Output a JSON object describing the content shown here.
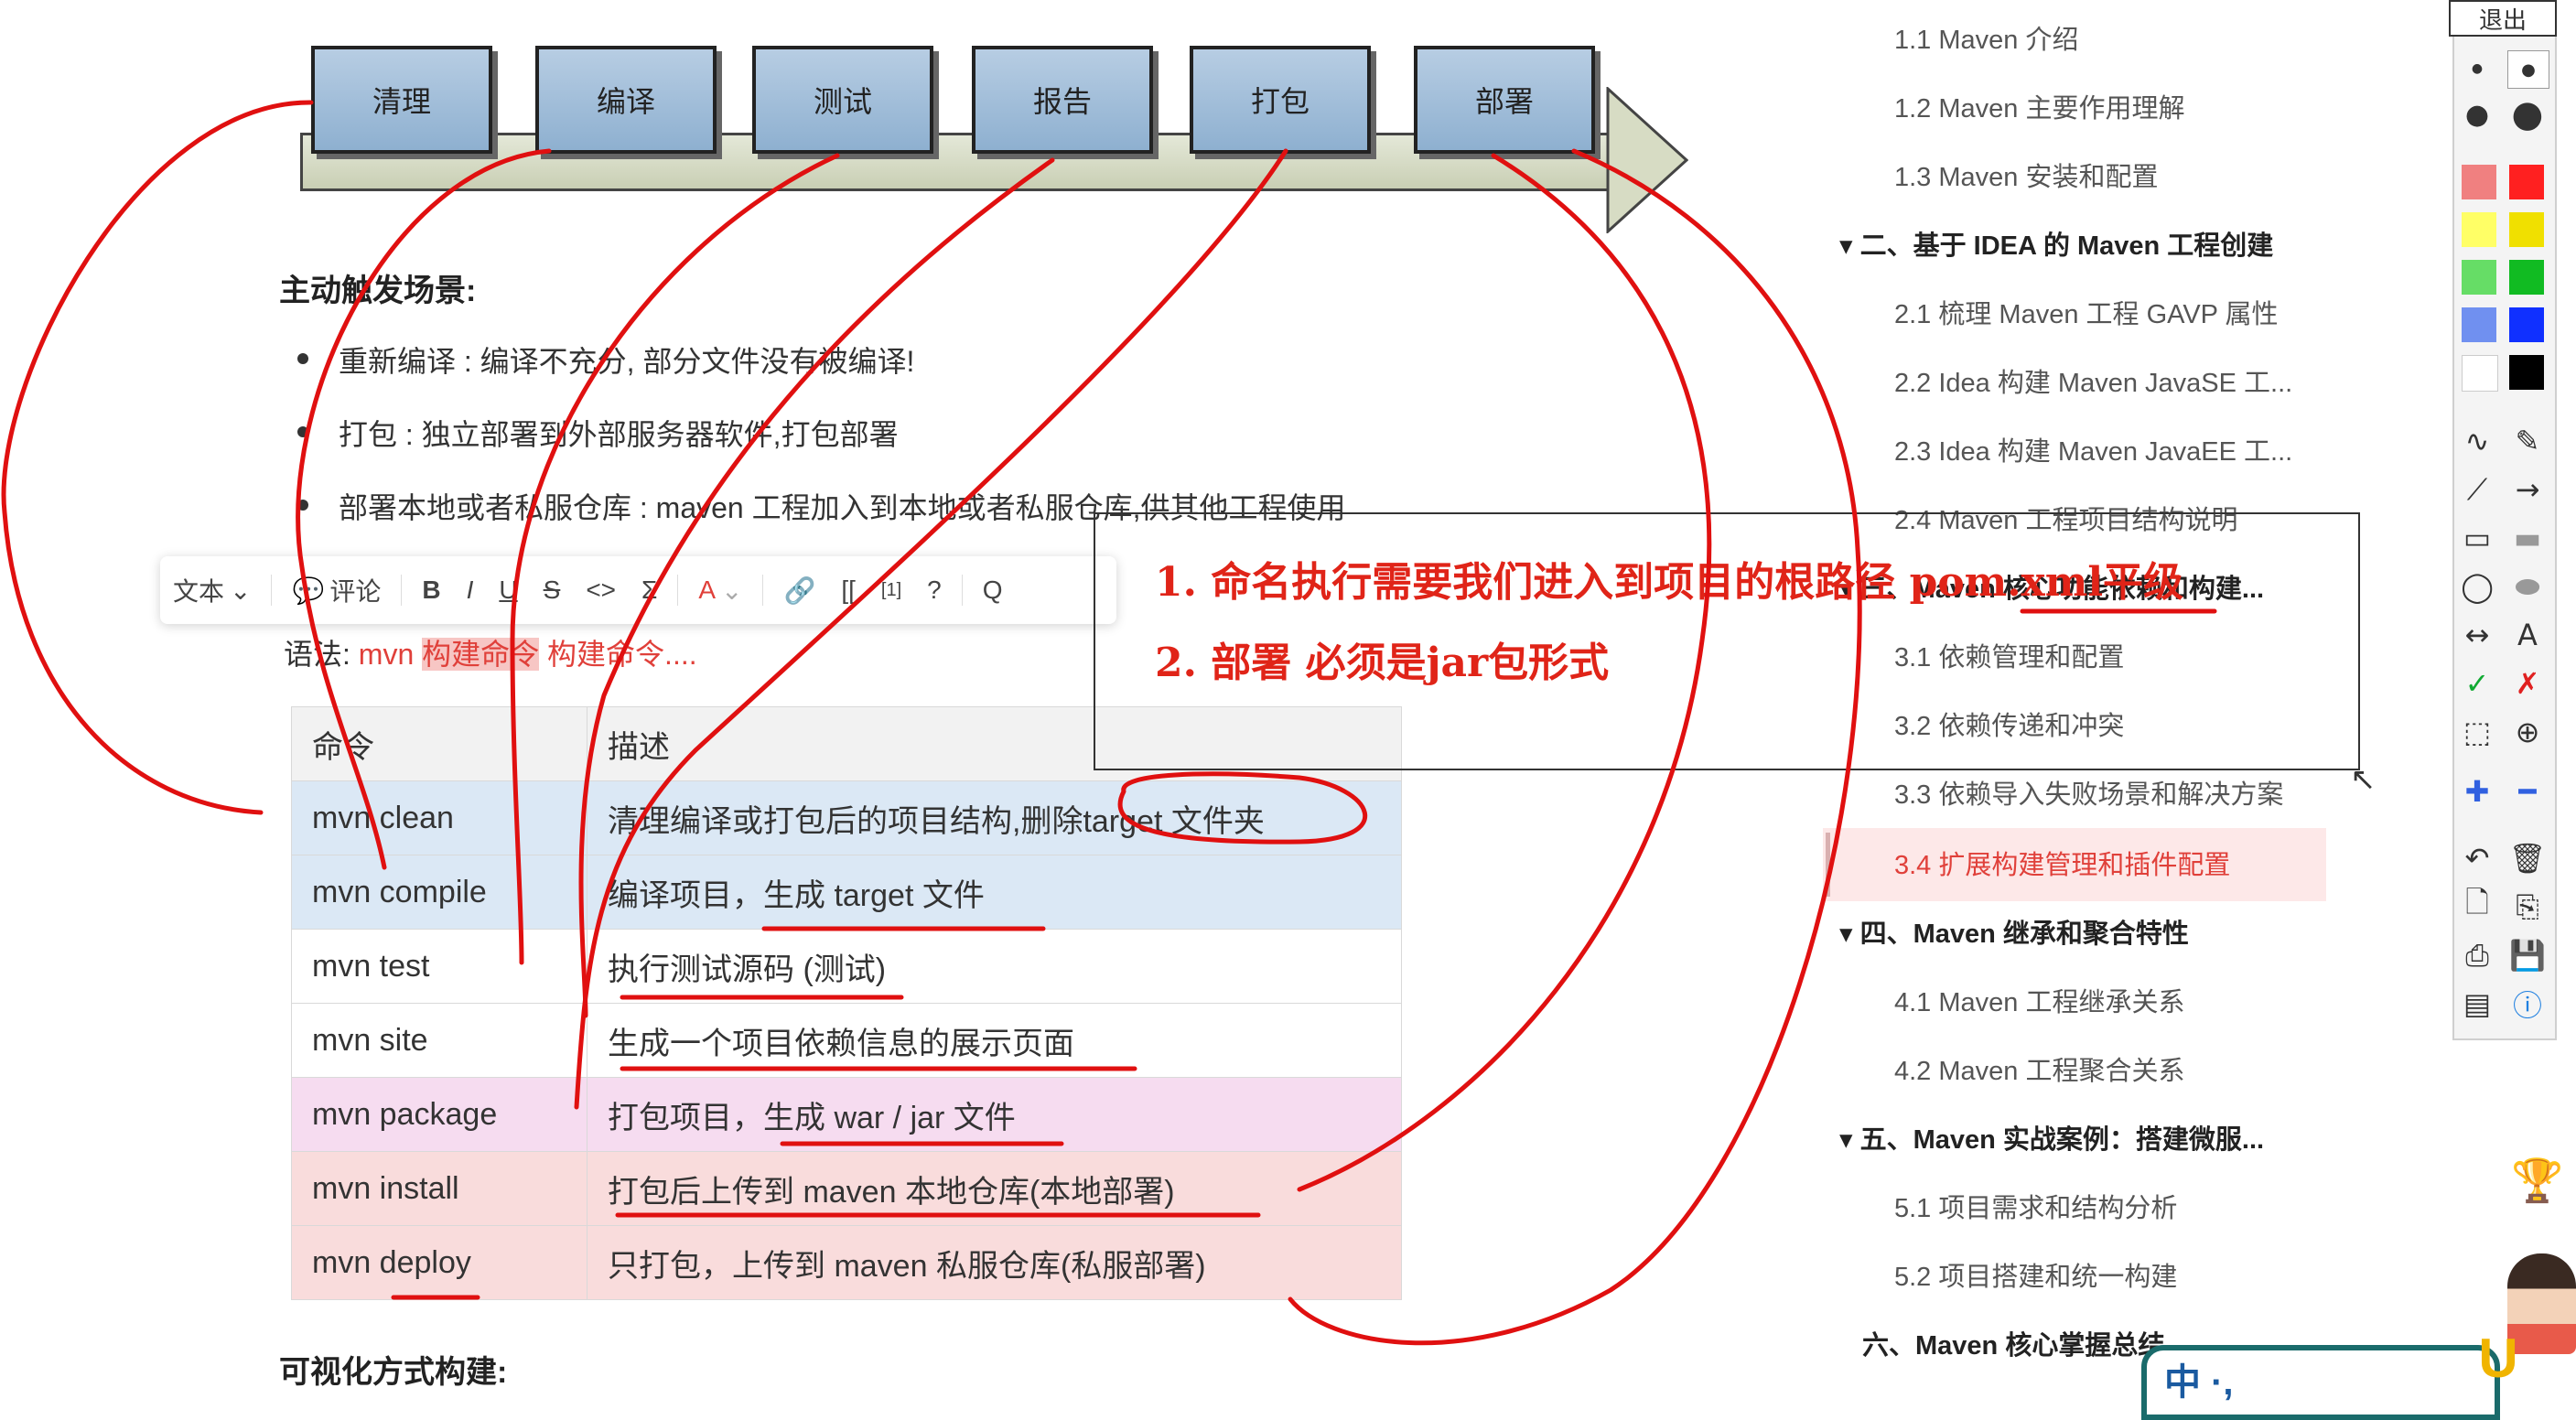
{
  "process_steps": [
    "清理",
    "编译",
    "测试",
    "报告",
    "打包",
    "部署"
  ],
  "section_trigger": "主动触发场景:",
  "bullets": [
    "重新编译 : 编译不充分, 部分文件没有被编译!",
    "打包 : 独立部署到外部服务器软件,打包部署",
    "部署本地或者私服仓库 : maven 工程加入到本地或者私服仓库,供其他工程使用"
  ],
  "toolbar": {
    "text_style": "文本",
    "comment": "评论",
    "bold": "B",
    "italic": "I",
    "underline": "U",
    "strike": "S",
    "code": "<>",
    "formula": "Σ",
    "font_color": "A",
    "link": "🔗",
    "bracket": "[[",
    "superscript": "[1]",
    "help": "?",
    "search": "Q"
  },
  "syntax": {
    "prefix": "语法: ",
    "cmd": "mvn ",
    "highlight": "构建命令",
    "suffix": "  构建命令...."
  },
  "table": {
    "headers": [
      "命令",
      "描述"
    ],
    "rows": [
      {
        "cmd": "mvn clean",
        "desc": "清理编译或打包后的项目结构,删除target 文件夹"
      },
      {
        "cmd": "mvn compile",
        "desc": "编译项目，生成 target 文件"
      },
      {
        "cmd": "mvn test",
        "desc": "执行测试源码 (测试)"
      },
      {
        "cmd": "mvn site",
        "desc": "生成一个项目依赖信息的展示页面"
      },
      {
        "cmd": "mvn package",
        "desc": "打包项目，生成 war / jar 文件"
      },
      {
        "cmd": "mvn install",
        "desc": "打包后上传到 maven 本地仓库(本地部署)"
      },
      {
        "cmd": "mvn deploy",
        "desc": "只打包，上传到 maven 私服仓库(私服部署)"
      }
    ]
  },
  "section_visual": "可视化方式构建:",
  "notes": [
    "1. 命名执行需要我们进入到项目的根路径 pom.xml平级",
    "2. 部署 必须是jar包形式"
  ],
  "toc": {
    "items": [
      {
        "label": "1.1 Maven 介绍",
        "level": "sub"
      },
      {
        "label": "1.2 Maven 主要作用理解",
        "level": "sub"
      },
      {
        "label": "1.3 Maven 安装和配置",
        "level": "sub"
      },
      {
        "label": "▾ 二、基于 IDEA 的 Maven 工程创建",
        "level": "head"
      },
      {
        "label": "2.1 梳理 Maven 工程 GAVP 属性",
        "level": "sub"
      },
      {
        "label": "2.2 Idea 构建 Maven JavaSE 工...",
        "level": "sub"
      },
      {
        "label": "2.3 Idea 构建 Maven JavaEE 工...",
        "level": "sub"
      },
      {
        "label": "2.4 Maven 工程项目结构说明",
        "level": "sub"
      },
      {
        "label": "▾ 三、Maven 核心功能依赖和构建...",
        "level": "head"
      },
      {
        "label": "3.1 依赖管理和配置",
        "level": "sub"
      },
      {
        "label": "3.2 依赖传递和冲突",
        "level": "sub"
      },
      {
        "label": "3.3 依赖导入失败场景和解决方案",
        "level": "sub"
      },
      {
        "label": "3.4 扩展构建管理和插件配置",
        "level": "sub",
        "active": true
      },
      {
        "label": "▾ 四、Maven 继承和聚合特性",
        "level": "head"
      },
      {
        "label": "4.1 Maven 工程继承关系",
        "level": "sub"
      },
      {
        "label": "4.2 Maven 工程聚合关系",
        "level": "sub"
      },
      {
        "label": "▾ 五、Maven 实战案例：搭建微服...",
        "level": "head"
      },
      {
        "label": "5.1 项目需求和结构分析",
        "level": "sub"
      },
      {
        "label": "5.2 项目搭建和统一构建",
        "level": "sub"
      },
      {
        "label": "六、Maven 核心掌握总结",
        "level": "head"
      }
    ]
  },
  "palette": {
    "exit_label": "退出",
    "colors": [
      "#f08080",
      "#ff2020",
      "#ffff66",
      "#f0e000",
      "#66dd66",
      "#11bb22",
      "#7090f0",
      "#1030ff",
      "#ffffff",
      "#000000"
    ]
  },
  "ime": {
    "label": "中 ·, "
  }
}
